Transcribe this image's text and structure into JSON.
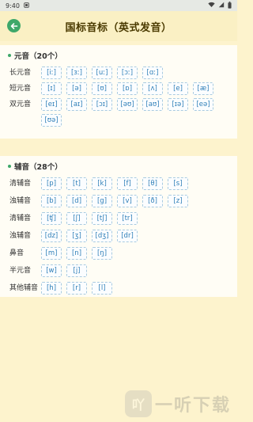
{
  "status": {
    "time": "9:40",
    "icons": [
      "notification-icon",
      "wifi-icon",
      "signal-icon",
      "battery-icon"
    ]
  },
  "header": {
    "title": "国标音标（英式发音）",
    "back_icon": "back-arrow-icon"
  },
  "vowels": {
    "title": "元音（20个）",
    "rows": [
      {
        "label": "长元音",
        "items": [
          "[iː]",
          "[ɜː]",
          "[uː]",
          "[ɔː]",
          "[ɑː]"
        ]
      },
      {
        "label": "短元音",
        "items": [
          "[ɪ]",
          "[ə]",
          "[ʊ]",
          "[ɒ]",
          "[ʌ]",
          "[e]",
          "[æ]"
        ]
      },
      {
        "label": "双元音",
        "items": [
          "[eɪ]",
          "[aɪ]",
          "[ɔɪ]",
          "[əʊ]",
          "[aʊ]",
          "[ɪə]",
          "[eə]",
          "[ʊə]"
        ]
      }
    ]
  },
  "consonants": {
    "title": "辅音（28个）",
    "rows": [
      {
        "label": "清辅音",
        "items": [
          "[p]",
          "[t]",
          "[k]",
          "[f]",
          "[θ]",
          "[s]"
        ]
      },
      {
        "label": "浊辅音",
        "items": [
          "[b]",
          "[d]",
          "[g]",
          "[v]",
          "[ð]",
          "[z]"
        ]
      },
      {
        "label": "清辅音",
        "items": [
          "[ʧ]",
          "[ʃ]",
          "[tʃ]",
          "[tr]"
        ]
      },
      {
        "label": "浊辅音",
        "items": [
          "[dz]",
          "[ʒ]",
          "[dʒ]",
          "[dr]"
        ]
      },
      {
        "label": "鼻音",
        "items": [
          "[m]",
          "[n]",
          "[ŋ]"
        ]
      },
      {
        "label": "半元音",
        "items": [
          "[w]",
          "[j]"
        ]
      },
      {
        "label": "其他辅音",
        "items": [
          "[h]",
          "[r]",
          "[l]"
        ]
      }
    ]
  },
  "watermark": {
    "logo": "吖",
    "text": "一听下载"
  },
  "colors": {
    "accent": "#3ea86a",
    "chip_text": "#2f7fb8",
    "background": "#fdf3cd"
  }
}
